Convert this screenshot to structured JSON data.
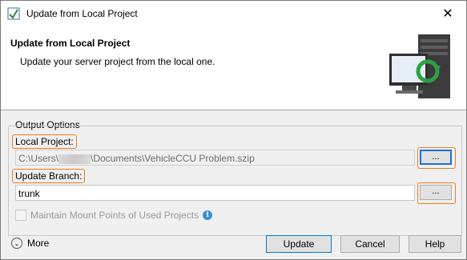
{
  "window": {
    "title": "Update from Local Project",
    "close_glyph": "✕"
  },
  "header": {
    "title": "Update from Local Project",
    "subtitle": "Update your server project from the local one."
  },
  "options": {
    "group_title": "Output Options",
    "local_project": {
      "label": "Local Project:",
      "path_prefix": "C:\\Users\\",
      "path_suffix": "\\Documents\\VehicleCCU Problem.szip",
      "browse_label": "..."
    },
    "update_branch": {
      "label": "Update Branch:",
      "value": "trunk",
      "browse_label": "..."
    },
    "maintain_mount": {
      "label": "Maintain Mount Points of Used Projects",
      "checked": false,
      "enabled": false,
      "info_glyph": "i"
    }
  },
  "footer": {
    "more_label": "More",
    "more_glyph": "⌄",
    "update_label": "Update",
    "cancel_label": "Cancel",
    "help_label": "Help"
  },
  "colors": {
    "highlight": "#f07d1a",
    "focus": "#1f6fd6"
  }
}
